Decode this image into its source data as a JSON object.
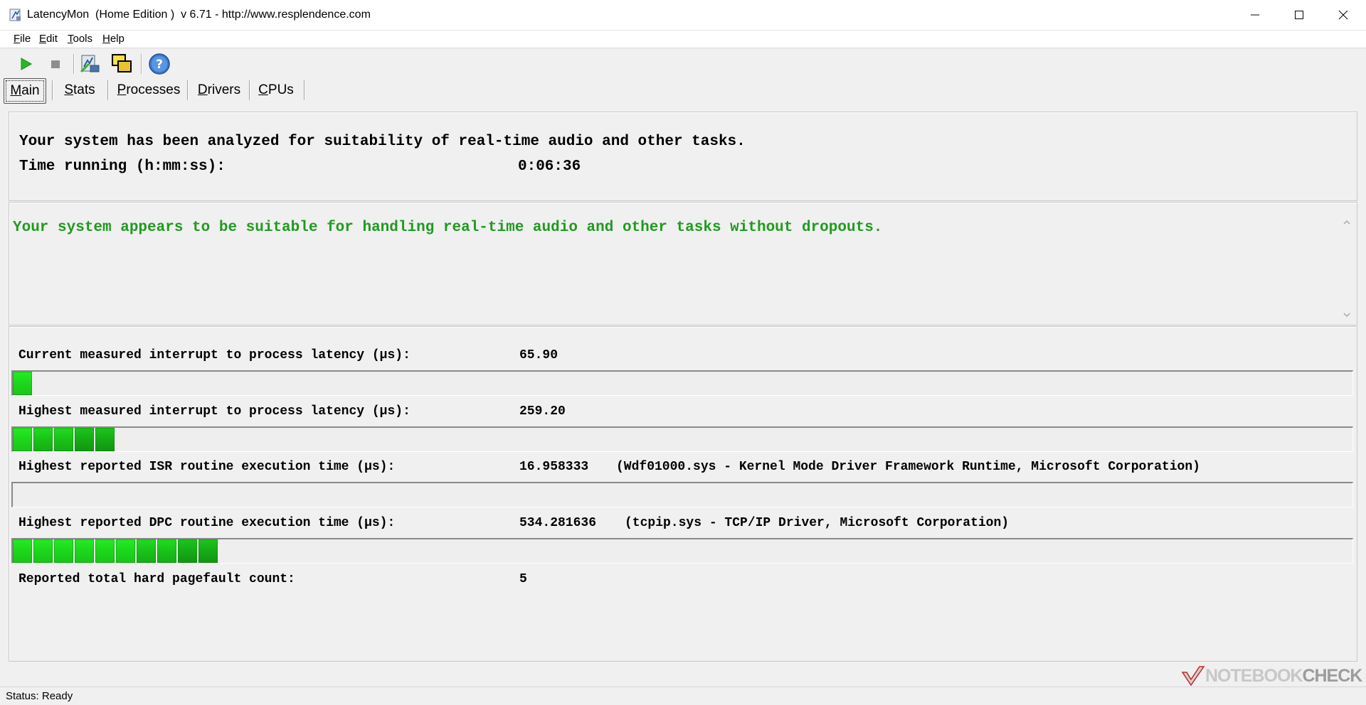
{
  "window": {
    "title": "LatencyMon  (Home Edition )  v 6.71 - http://www.resplendence.com"
  },
  "menu": [
    {
      "mnemonic": "F",
      "rest": "ile"
    },
    {
      "mnemonic": "E",
      "rest": "dit"
    },
    {
      "mnemonic": "T",
      "rest": "ools"
    },
    {
      "mnemonic": "H",
      "rest": "elp"
    }
  ],
  "toolbar": {
    "icons": [
      "play-icon",
      "stop-icon",
      "analysis-icon",
      "windows-icon",
      "help-icon"
    ]
  },
  "tabs": [
    {
      "mnemonic": "M",
      "rest": "ain"
    },
    {
      "mnemonic": "S",
      "rest": "tats"
    },
    {
      "mnemonic": "P",
      "rest": "rocesses"
    },
    {
      "mnemonic": "D",
      "rest": "rivers"
    },
    {
      "mnemonic": "C",
      "rest": "PUs"
    }
  ],
  "active_tab": "Main",
  "summary": {
    "analyzed": "Your system has been analyzed for suitability of real-time audio and other tasks.",
    "time_label": "Time running (h:mm:ss):",
    "time_value": "0:06:36"
  },
  "result": {
    "message": "Your system appears to be suitable for handling real-time audio and other tasks without dropouts.",
    "color": "#1f9b1f"
  },
  "metrics": [
    {
      "label": "Current measured interrupt to process latency (µs):",
      "value": "65.90",
      "driver": "",
      "bar_segments": 1
    },
    {
      "label": "Highest measured interrupt to process latency (µs):",
      "value": "259.20",
      "driver": "",
      "bar_segments": 5
    },
    {
      "label": "Highest reported ISR routine execution time (µs):",
      "value": "16.958333",
      "driver": "(Wdf01000.sys - Kernel Mode Driver Framework Runtime, Microsoft Corporation)",
      "bar_segments": 0
    },
    {
      "label": "Highest reported DPC routine execution time (µs):",
      "value": "534.281636",
      "driver": "(tcpip.sys - TCP/IP Driver, Microsoft Corporation)",
      "bar_segments": 10
    },
    {
      "label": "Reported total hard pagefault count:",
      "value": "5",
      "driver": ""
    }
  ],
  "status": {
    "text": "Status: Ready"
  },
  "watermark": {
    "part1": "NOTEBOOK",
    "part2": "CHECK"
  }
}
